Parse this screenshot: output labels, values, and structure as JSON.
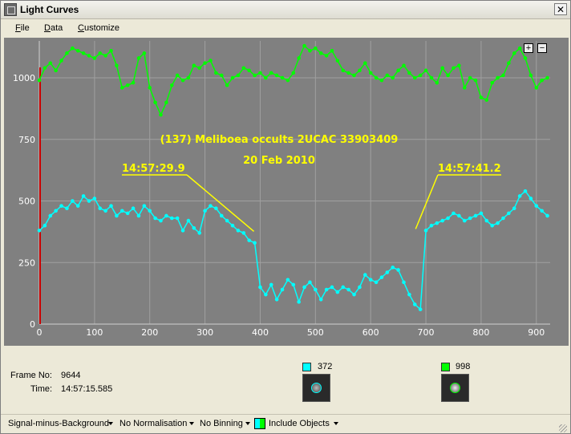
{
  "window": {
    "title": "Light Curves",
    "close_label": "✕"
  },
  "menu": [
    {
      "label": "File"
    },
    {
      "label": "Data"
    },
    {
      "label": "Customize"
    }
  ],
  "zoom": {
    "plus": "+",
    "minus": "−"
  },
  "chart_data": {
    "type": "line",
    "title": "",
    "xlabel": "",
    "ylabel": "",
    "xlim": [
      0,
      925
    ],
    "ylim": [
      0,
      1150
    ],
    "x_ticks": [
      0,
      100,
      200,
      300,
      400,
      500,
      600,
      700,
      800,
      900
    ],
    "y_ticks": [
      0,
      250,
      500,
      750,
      1000
    ],
    "grid": true,
    "colors": {
      "background": "#808080",
      "grid": "#a0a0a0",
      "cyan": "#00ffff",
      "green": "#00ff00",
      "annotation": "#ffff00",
      "cursor": "#cc0000"
    },
    "cursor_x": 0,
    "series": [
      {
        "color": "#00ff00",
        "x": [
          0,
          10,
          20,
          30,
          40,
          50,
          60,
          70,
          80,
          90,
          100,
          110,
          120,
          130,
          140,
          150,
          160,
          170,
          180,
          190,
          200,
          210,
          220,
          230,
          240,
          250,
          260,
          270,
          280,
          290,
          300,
          310,
          320,
          330,
          340,
          350,
          360,
          370,
          380,
          390,
          400,
          410,
          420,
          430,
          440,
          450,
          460,
          470,
          480,
          490,
          500,
          510,
          520,
          530,
          540,
          550,
          560,
          570,
          580,
          590,
          600,
          610,
          620,
          630,
          640,
          650,
          660,
          670,
          680,
          690,
          700,
          710,
          720,
          730,
          740,
          750,
          760,
          770,
          780,
          790,
          800,
          810,
          820,
          830,
          840,
          850,
          860,
          870,
          880,
          890,
          900,
          910,
          920
        ],
        "y": [
          990,
          1040,
          1060,
          1030,
          1070,
          1100,
          1120,
          1110,
          1100,
          1090,
          1080,
          1100,
          1090,
          1110,
          1050,
          960,
          970,
          980,
          1080,
          1100,
          960,
          900,
          850,
          900,
          970,
          1010,
          990,
          1000,
          1050,
          1040,
          1060,
          1070,
          1020,
          1010,
          970,
          1000,
          1010,
          1040,
          1030,
          1010,
          1020,
          1000,
          1020,
          1010,
          1000,
          990,
          1020,
          1080,
          1130,
          1110,
          1120,
          1100,
          1090,
          1110,
          1070,
          1030,
          1020,
          1010,
          1030,
          1060,
          1020,
          1000,
          990,
          1010,
          1000,
          1030,
          1050,
          1020,
          1000,
          1010,
          1030,
          1000,
          980,
          1040,
          1010,
          1040,
          1050,
          960,
          1000,
          990,
          920,
          910,
          980,
          1000,
          1010,
          1060,
          1100,
          1120,
          1080,
          1010,
          960,
          990,
          1000
        ]
      },
      {
        "color": "#00ffff",
        "x": [
          0,
          10,
          20,
          30,
          40,
          50,
          60,
          70,
          80,
          90,
          100,
          110,
          120,
          130,
          140,
          150,
          160,
          170,
          180,
          190,
          200,
          210,
          220,
          230,
          240,
          250,
          260,
          270,
          280,
          290,
          300,
          310,
          320,
          330,
          340,
          350,
          360,
          370,
          380,
          390,
          400,
          410,
          420,
          430,
          440,
          450,
          460,
          470,
          480,
          490,
          500,
          510,
          520,
          530,
          540,
          550,
          560,
          570,
          580,
          590,
          600,
          610,
          620,
          630,
          640,
          650,
          660,
          670,
          680,
          690,
          700,
          710,
          720,
          730,
          740,
          750,
          760,
          770,
          780,
          790,
          800,
          810,
          820,
          830,
          840,
          850,
          860,
          870,
          880,
          890,
          900,
          910,
          920
        ],
        "y": [
          380,
          400,
          440,
          460,
          480,
          470,
          500,
          480,
          520,
          500,
          510,
          470,
          460,
          480,
          440,
          460,
          450,
          470,
          440,
          480,
          460,
          430,
          420,
          440,
          430,
          430,
          380,
          420,
          390,
          370,
          460,
          480,
          470,
          440,
          420,
          400,
          380,
          370,
          340,
          330,
          150,
          120,
          160,
          100,
          140,
          180,
          160,
          90,
          150,
          170,
          140,
          100,
          140,
          150,
          130,
          150,
          140,
          120,
          150,
          200,
          180,
          170,
          190,
          210,
          230,
          220,
          170,
          120,
          80,
          60,
          380,
          400,
          410,
          420,
          430,
          450,
          440,
          420,
          430,
          440,
          450,
          420,
          400,
          410,
          430,
          450,
          470,
          520,
          540,
          510,
          480,
          460,
          440
        ]
      }
    ],
    "annotations": [
      {
        "text": "(137) Meliboea occults 2UCAC 33903409"
      },
      {
        "text": "20 Feb 2010"
      },
      {
        "text": "14:57:29.9",
        "target_x": 390,
        "target_y": 370
      },
      {
        "text": "14:57:41.2",
        "target_x": 680,
        "target_y": 380
      }
    ]
  },
  "info": {
    "frame_label": "Frame No:",
    "frame_value": "9644",
    "time_label": "Time:",
    "time_value": "14:57:15.585"
  },
  "objects": [
    {
      "value": "372",
      "color": "#00ffff"
    },
    {
      "value": "998",
      "color": "#00ff00"
    }
  ],
  "toolbar": [
    {
      "label": "Signal-minus-Background"
    },
    {
      "label": "No Normalisation"
    },
    {
      "label": "No Binning"
    },
    {
      "label": "Include Objects"
    }
  ]
}
